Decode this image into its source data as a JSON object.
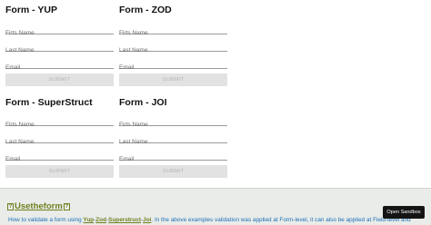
{
  "forms": [
    {
      "title": "Form - YUP",
      "first_name_placeholder": "Firts Name",
      "last_name_placeholder": "Last Name",
      "email_placeholder": "Email",
      "submit_label": "SUBMIT"
    },
    {
      "title": "Form - ZOD",
      "first_name_placeholder": "Firts Name",
      "last_name_placeholder": "Last Name",
      "email_placeholder": "Email",
      "submit_label": "SUBMIT"
    },
    {
      "title": "Form - SuperStruct",
      "first_name_placeholder": "Firts Name",
      "last_name_placeholder": "Last Name",
      "email_placeholder": "Email",
      "submit_label": "SUBMIT"
    },
    {
      "title": "Form - JOI",
      "first_name_placeholder": "Firts Name",
      "last_name_placeholder": "Last Name",
      "email_placeholder": "Email",
      "submit_label": "SUBMIT"
    }
  ],
  "footer": {
    "title_prefix": "?",
    "title": "Usetheform",
    "title_suffix": "?",
    "desc_start": "How to validate a form using",
    "kw_yup": "Yup",
    "kw_zod": "Zod",
    "kw_superstruct": "Superstruct",
    "kw_joi": "Joi",
    "desc_end": ". In the above examples validation was applied at Form-level, it can also be applied at Field-level and",
    "separator": "-"
  },
  "sandbox_button": {
    "label": "Open Sandbox"
  },
  "colors": {
    "accent_olive": "#6f7f1e",
    "link_blue": "#1d6fb8",
    "submit_disabled_bg": "#e2e2e2",
    "footer_bg": "#e9ece9"
  }
}
